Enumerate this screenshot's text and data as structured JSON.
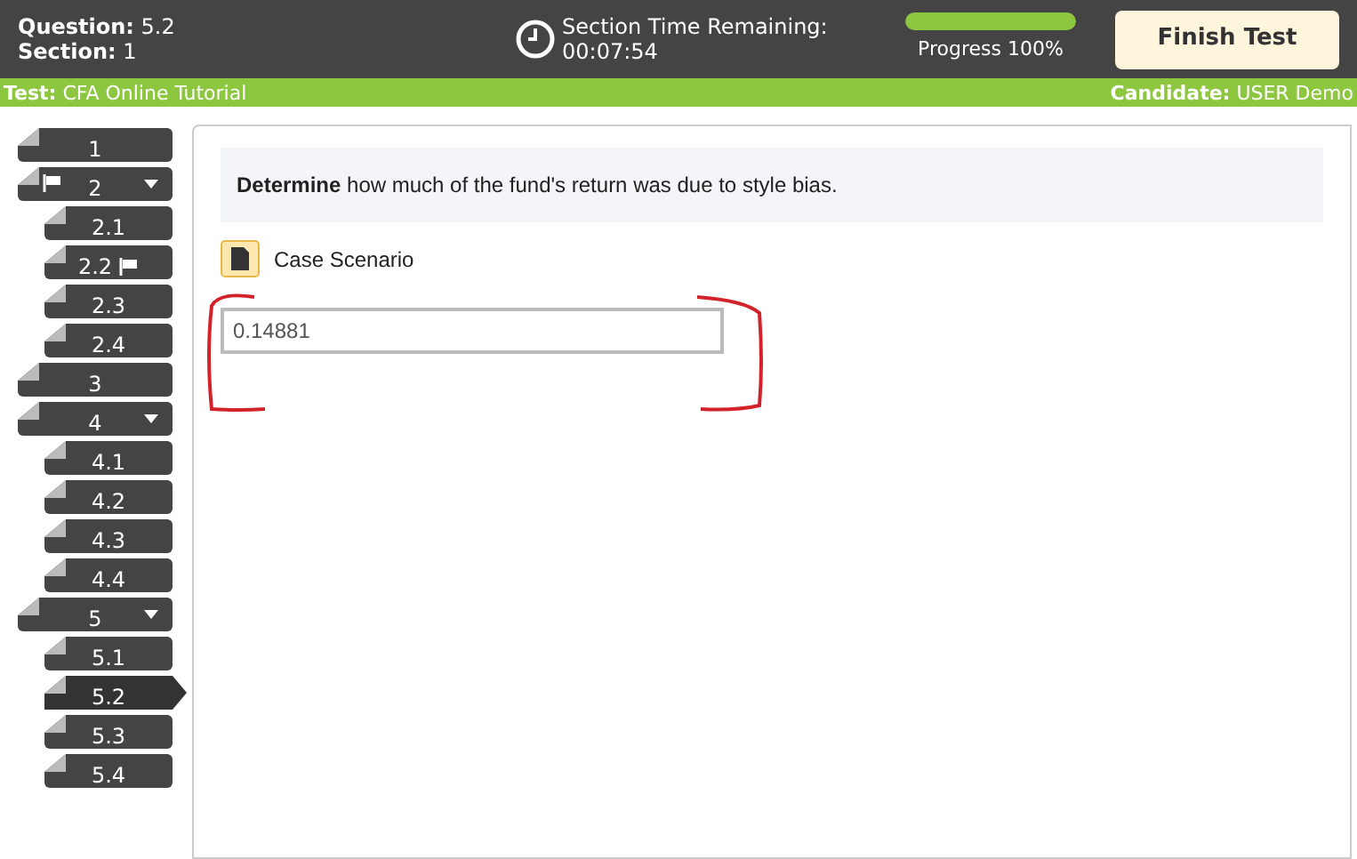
{
  "header": {
    "question_label": "Question:",
    "question": "5.2",
    "section_label": "Section:",
    "section": "1",
    "timer_label": "Section Time Remaining:",
    "timer": "00:07:54",
    "progress": {
      "level": 1,
      "label": "Progress 100%"
    },
    "finish_button": "Finish Test"
  },
  "info_bar": {
    "test_label": "Test:",
    "test": "CFA Online Tutorial",
    "candidate_label": "Candidate:",
    "candidate": "USER Demo"
  },
  "nav": [
    {
      "label": "1",
      "flagged": false,
      "selected": false
    },
    {
      "label": "2",
      "flagged": true,
      "expanded": true,
      "selected": false,
      "children": [
        {
          "label": "2.1",
          "flagged": false,
          "selected": false
        },
        {
          "label": "2.2",
          "flagged": true,
          "selected": false
        },
        {
          "label": "2.3",
          "flagged": false,
          "selected": false
        },
        {
          "label": "2.4",
          "flagged": false,
          "selected": false
        }
      ]
    },
    {
      "label": "3",
      "flagged": false,
      "selected": false
    },
    {
      "label": "4",
      "flagged": false,
      "expanded": true,
      "selected": false,
      "children": [
        {
          "label": "4.1",
          "flagged": false,
          "selected": false
        },
        {
          "label": "4.2",
          "flagged": false,
          "selected": false
        },
        {
          "label": "4.3",
          "flagged": false,
          "selected": false
        },
        {
          "label": "4.4",
          "flagged": false,
          "selected": false
        }
      ]
    },
    {
      "label": "5",
      "flagged": false,
      "expanded": true,
      "selected": false,
      "children": [
        {
          "label": "5.1",
          "flagged": false,
          "selected": false
        },
        {
          "label": "5.2",
          "flagged": false,
          "selected": true
        },
        {
          "label": "5.3",
          "flagged": false,
          "selected": false
        },
        {
          "label": "5.4",
          "flagged": false,
          "selected": false
        }
      ]
    }
  ],
  "question": {
    "prompt": "**Determine** how much of the fund's return was due to style bias.",
    "case_link": "Case Scenario",
    "answer": "0.14881"
  }
}
